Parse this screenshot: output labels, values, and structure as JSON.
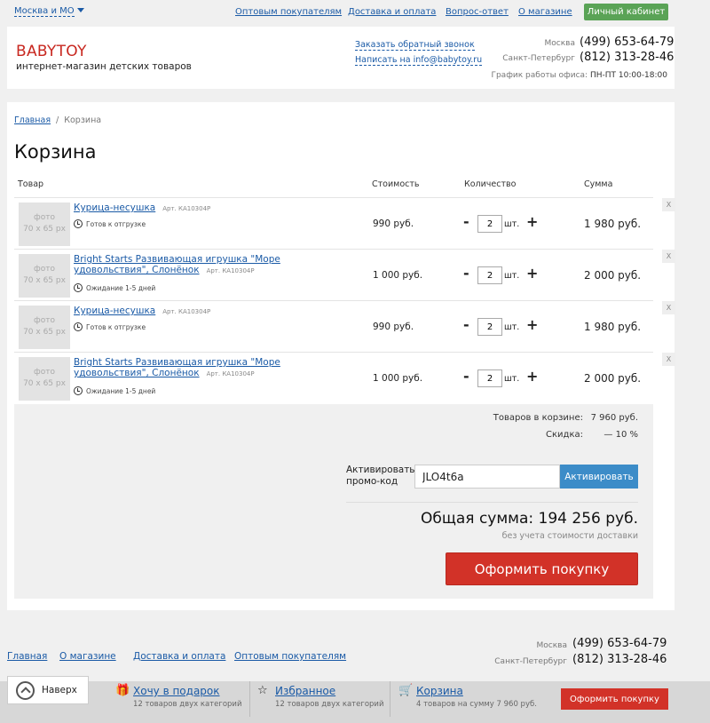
{
  "topbar": {
    "city": "Москва и МО",
    "nav": [
      "Оптовым покупателям",
      "Доставка и оплата",
      "Вопрос-ответ",
      "О магазине"
    ],
    "cabinet_label": "Личный кабинет"
  },
  "header": {
    "logo": "BABYTOY",
    "tagline": "интернет-магазин детских товаров",
    "callback_link": "Заказать обратный звонок",
    "email_link": "Написать на info@babytoy.ru",
    "phones": [
      {
        "city": "Москва",
        "number": "(499) 653-64-79"
      },
      {
        "city": "Санкт-Петербург",
        "number": "(812) 313-28-46"
      }
    ],
    "hours_label": "График работы офиса:",
    "hours_value": "ПН-ПТ 10:00-18:00"
  },
  "breadcrumb": {
    "home": "Главная",
    "sep": "/",
    "current": "Корзина"
  },
  "page_title": "Корзина",
  "table_headers": {
    "product": "Товар",
    "price": "Стоимость",
    "qty": "Количество",
    "sum": "Сумма"
  },
  "items": [
    {
      "photo_line1": "фото",
      "photo_line2": "70 х 65 px",
      "name": "Курица-несушка",
      "art": "Арт. КА10304Р",
      "status": "Готов к отгрузке",
      "price": "990 руб.",
      "qty": "2",
      "unit": "шт.",
      "sum": "1 980 руб.",
      "minus": "-",
      "plus": "+",
      "remove": "X"
    },
    {
      "photo_line1": "фото",
      "photo_line2": "70 х 65 px",
      "name": "Bright Starts Развивающая игрушка \"Море удовольствия\", Слонёнок",
      "art": "Арт. КА10304Р",
      "status": "Ожидание 1-5 дней",
      "price": "1 000 руб.",
      "qty": "2",
      "unit": "шт.",
      "sum": "2 000 руб.",
      "minus": "-",
      "plus": "+",
      "remove": "X"
    },
    {
      "photo_line1": "фото",
      "photo_line2": "70 х 65 px",
      "name": "Курица-несушка",
      "art": "Арт. КА10304Р",
      "status": "Готов к отгрузке",
      "price": "990 руб.",
      "qty": "2",
      "unit": "шт.",
      "sum": "1 980 руб.",
      "minus": "-",
      "plus": "+",
      "remove": "X"
    },
    {
      "photo_line1": "фото",
      "photo_line2": "70 х 65 px",
      "name": "Bright Starts Развивающая игрушка \"Море удовольствия\", Слонёнок",
      "art": "Арт. КА10304Р",
      "status": "Ожидание 1-5 дней",
      "price": "1 000 руб.",
      "qty": "2",
      "unit": "шт.",
      "sum": "2 000 руб.",
      "minus": "-",
      "plus": "+",
      "remove": "X"
    }
  ],
  "totals": {
    "in_cart_label": "Товаров в корзине:",
    "in_cart_value": "7 960 руб.",
    "discount_label": "Скидка:",
    "discount_value": "— 10 %",
    "promo_label_1": "Активировать",
    "promo_label_2": "промо-код",
    "promo_value": "JLO4t6a",
    "promo_button": "Активировать",
    "grand_total": "Общая сумма: 194 256 руб.",
    "grand_sub": "без учета стоимости доставки",
    "checkout_button": "Оформить покупку"
  },
  "footer": {
    "nav": [
      "Главная",
      "О магазине",
      "Доставка и оплата",
      "Оптовым покупателям"
    ],
    "phones": [
      {
        "city": "Москва",
        "number": "(499) 653-64-79"
      },
      {
        "city": "Санкт-Петербург",
        "number": "(812) 313-28-46"
      }
    ]
  },
  "sticky": {
    "back_top": "Наверх",
    "gift": {
      "icon": "gift-icon",
      "name": "Хочу в подарок",
      "sub": "12 товаров двух категорий"
    },
    "fav": {
      "icon": "star-icon",
      "name": "Избранное",
      "sub": "12 товаров двух категорий"
    },
    "cart": {
      "icon": "cart-icon",
      "name": "Корзина",
      "sub": "4 товаров на сумму 7 960 руб."
    },
    "checkout_button": "Оформить покупку"
  },
  "colors": {
    "link": "#1a5aa6",
    "brand": "#c8271f",
    "cabinet": "#5aa356",
    "promo_button": "#3c8cc8",
    "checkout": "#d23228"
  }
}
